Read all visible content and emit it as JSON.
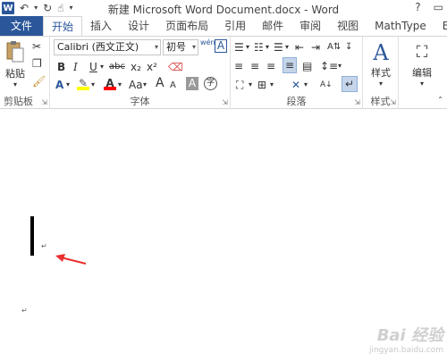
{
  "window": {
    "title": "新建 Microsoft Word Document.docx - Word",
    "help": "?",
    "restore": "▭",
    "close": "×"
  },
  "qat": {
    "app_icon": "W"
  },
  "tabs": [
    "文件",
    "开始",
    "插入",
    "设计",
    "页面布局",
    "引用",
    "邮件",
    "审阅",
    "视图",
    "MathType",
    "Ea"
  ],
  "ribbon": {
    "clipboard": {
      "paste_label": "粘贴",
      "group_label": "剪贴板"
    },
    "font": {
      "font_name": "Calibri (西文正文)",
      "font_size": "初号",
      "group_label": "字体",
      "bold": "B",
      "italic": "I",
      "underline": "U",
      "strike": "abc",
      "subscript": "x₂",
      "superscript": "x²",
      "case": "Aa",
      "grow": "A",
      "shrink": "A",
      "wen": "wén",
      "char_border": "A"
    },
    "paragraph": {
      "group_label": "段落"
    },
    "styles": {
      "label": "样式",
      "group_label": "样式"
    },
    "editing": {
      "label": "编辑"
    }
  },
  "document": {
    "paragraph_marks": [
      "↵",
      "↵"
    ]
  },
  "watermark": {
    "line1": "Bai 经验",
    "line2": "jingyan.baidu.com"
  },
  "colors": {
    "word_blue": "#2b579a",
    "annotation_red": "#e8312f",
    "highlight_yellow": "#ffff00",
    "font_red": "#ff0000"
  }
}
